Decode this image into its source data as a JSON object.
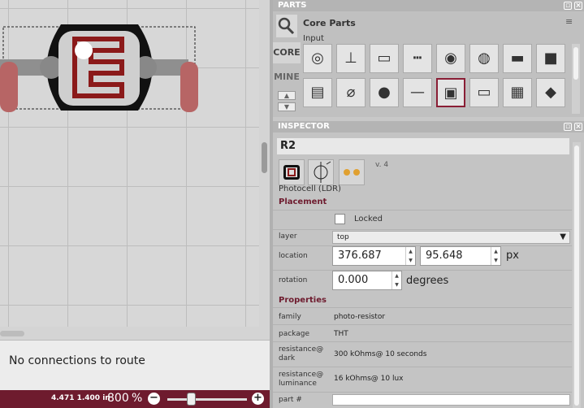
{
  "routing_status": "No connections to route",
  "status": {
    "coords": "4.471 1.400 in",
    "zoom_value": "800",
    "zoom_unit": "%",
    "zoom_minus": "−",
    "zoom_plus": "+",
    "zoom_slider_level_percent": 28
  },
  "parts": {
    "header": "PARTS",
    "bin_title": "Core Parts",
    "category": "Input",
    "bin_core": "CORE",
    "bin_mine": "MINE",
    "menu_icon": "≡",
    "tiles": [
      {
        "name": "rotary-potentiometer",
        "selected": false
      },
      {
        "name": "joystick",
        "selected": false
      },
      {
        "name": "slide-switch",
        "selected": false
      },
      {
        "name": "header-strip",
        "selected": false
      },
      {
        "name": "rotary-encoder",
        "selected": false
      },
      {
        "name": "trimmer-potentiometer",
        "selected": false
      },
      {
        "name": "reed-switch",
        "selected": false
      },
      {
        "name": "pushbutton",
        "selected": false
      },
      {
        "name": "dip-switch",
        "selected": false
      },
      {
        "name": "tilt-sensor",
        "selected": false
      },
      {
        "name": "mic-sensor",
        "selected": false
      },
      {
        "name": "flex-sensor",
        "selected": false
      },
      {
        "name": "photocell",
        "selected": true
      },
      {
        "name": "ir-sensor",
        "selected": false
      },
      {
        "name": "accelerometer-board",
        "selected": false
      },
      {
        "name": "temperature-sensor",
        "selected": false
      }
    ]
  },
  "inspector": {
    "header": "INSPECTOR",
    "title": "R2",
    "version": "v. 4",
    "part_title": "Photocell (LDR)",
    "placement_title": "Placement",
    "locked_label": "Locked",
    "layer_label": "layer",
    "layer_value": "top",
    "location_label": "location",
    "location_x": "376.687",
    "location_y": "95.648",
    "location_unit": "px",
    "rotation_label": "rotation",
    "rotation_value": "0.000",
    "rotation_unit": "degrees",
    "properties_title": "Properties",
    "props": {
      "family_label": "family",
      "family_value": "photo-resistor",
      "package_label": "package",
      "package_value": "THT",
      "res_dark_label": "resistance@ dark",
      "res_dark_value": "300 kOhms@ 10 seconds",
      "res_lum_label": "resistance@ luminance",
      "res_lum_value": "16 kOhms@ 10 lux",
      "part_num_label": "part #"
    }
  },
  "colors": {
    "accent": "#6e1b2e",
    "selection": "#8a1e35",
    "ldr_trace": "#8b1a1a",
    "lead": "#b76565"
  }
}
